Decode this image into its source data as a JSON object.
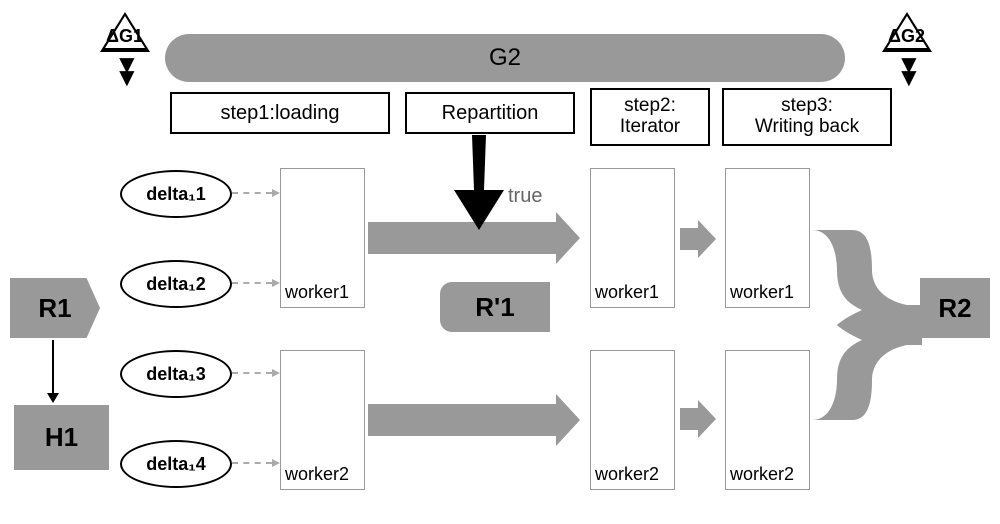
{
  "triangles": {
    "left": "ΔG1",
    "right": "ΔG2"
  },
  "pill_g2": "G2",
  "steps": {
    "s1": "step1:loading",
    "repartition": "Repartition",
    "s2": "step2:\nIterator",
    "s3": "step3:\nWriting back"
  },
  "deltas": {
    "d1": "delta₁1",
    "d2": "delta₁2",
    "d3": "delta₁3",
    "d4": "delta₁4"
  },
  "workers": {
    "load_w1": "worker1",
    "load_w2": "worker2",
    "iter_w1": "worker1",
    "iter_w2": "worker2",
    "wb_w1": "worker1",
    "wb_w2": "worker2"
  },
  "tags": {
    "r1": "R1",
    "h1": "H1",
    "rprime": "R'1",
    "r2": "R2"
  },
  "labels": {
    "true": "true"
  }
}
